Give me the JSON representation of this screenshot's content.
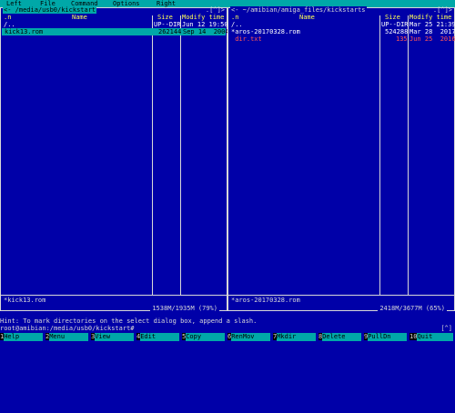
{
  "menu": {
    "items": [
      "Left",
      "File",
      "Command",
      "Options",
      "Right"
    ]
  },
  "left_panel": {
    "path": "<- /media/usb0/kickstart",
    "corner": ".[^]>",
    "headers": {
      "n": ".n",
      "name": "Name",
      "size": "Size",
      "mtime": "Modify time"
    },
    "rows": [
      {
        "name": "/..",
        "size": "UP--DIR",
        "mtime": "Jun 12 19:50"
      },
      {
        "name": "kick13.rom",
        "size": "262144",
        "mtime": "Sep 14  2004"
      }
    ],
    "status_name": "*kick13.rom",
    "free_space": "1538M/1935M (79%)"
  },
  "right_panel": {
    "path": "<- ~/amibian/amiga_files/kickstarts",
    "corner": ".[^]>",
    "headers": {
      "n": ".n",
      "name": "Name",
      "size": "Size",
      "mtime": "Modify time"
    },
    "rows": [
      {
        "name": "/..",
        "size": "UP--DIR",
        "mtime": "Mar 25 21:39"
      },
      {
        "name": "*aros-20170328.rom",
        "size": "524288",
        "mtime": "Mar 28  2017"
      },
      {
        "name": " dir.txt",
        "size": "135",
        "mtime": "Jun 25  2016"
      }
    ],
    "status_name": "*aros-20170328.rom",
    "free_space": "2418M/3677M (65%)"
  },
  "hint": "Hint: To mark directories on the select dialog box, append a slash.",
  "prompt": "root@amibian:/media/usb0/kickstart#",
  "scroll_hint": "[^]",
  "function_keys": [
    {
      "num": "1",
      "label": "Help"
    },
    {
      "num": "2",
      "label": "Menu"
    },
    {
      "num": "3",
      "label": "View"
    },
    {
      "num": "4",
      "label": "Edit"
    },
    {
      "num": "5",
      "label": "Copy"
    },
    {
      "num": "6",
      "label": "RenMov"
    },
    {
      "num": "7",
      "label": "Mkdir"
    },
    {
      "num": "8",
      "label": "Delete"
    },
    {
      "num": "9",
      "label": "PullDn"
    },
    {
      "num": "10",
      "label": "Quit"
    }
  ]
}
